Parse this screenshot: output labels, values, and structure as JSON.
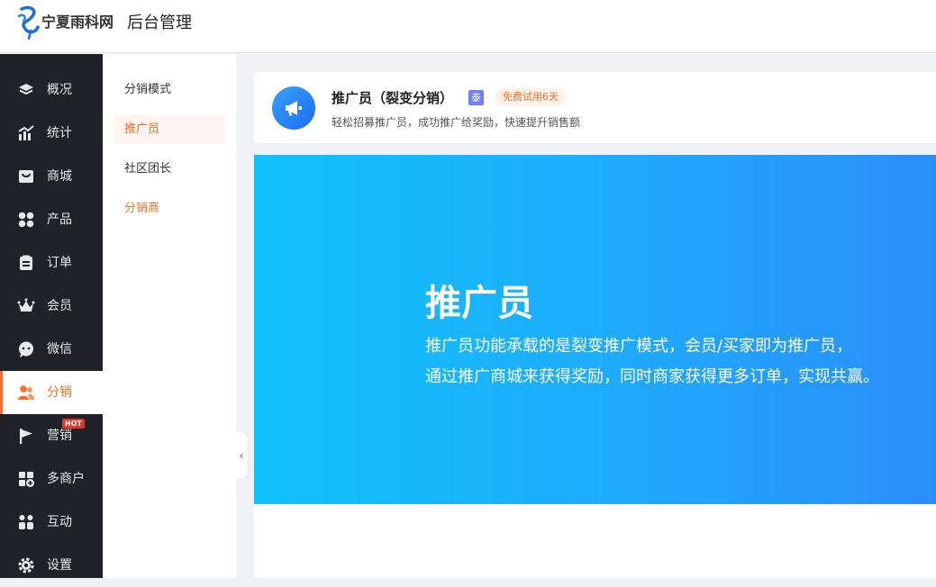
{
  "header": {
    "brand_text": "宁夏雨科网",
    "admin_title": "后台管理"
  },
  "sidebar": {
    "items": [
      {
        "label": "概况",
        "icon": "layers-icon"
      },
      {
        "label": "统计",
        "icon": "chart-icon"
      },
      {
        "label": "商城",
        "icon": "shop-icon"
      },
      {
        "label": "产品",
        "icon": "grid-icon"
      },
      {
        "label": "订单",
        "icon": "order-icon"
      },
      {
        "label": "会员",
        "icon": "crown-icon"
      },
      {
        "label": "微信",
        "icon": "chat-icon"
      },
      {
        "label": "分销",
        "icon": "users-icon",
        "active": true
      },
      {
        "label": "营销",
        "icon": "flag-icon",
        "badge": "HOT"
      },
      {
        "label": "多商户",
        "icon": "store-add-icon"
      },
      {
        "label": "互动",
        "icon": "interact-icon"
      },
      {
        "label": "设置",
        "icon": "gear-icon"
      }
    ]
  },
  "subnav": {
    "items": [
      {
        "label": "分销模式"
      },
      {
        "label": "推广员",
        "active": true
      },
      {
        "label": "社区团长"
      },
      {
        "label": "分销商"
      }
    ],
    "collapse_glyph": "‹"
  },
  "feature_card": {
    "title": "推广员（裂变分销）",
    "vip_badge": "泰",
    "trial_badge": "免费试用6天",
    "description": "轻松招募推广员，成功推广给奖励，快速提升销售额",
    "icon": "megaphone-icon"
  },
  "banner": {
    "title": "推广员",
    "line1": "推广员功能承载的是裂变推广模式，会员/买家即为推广员，",
    "line2": "通过推广商城来获得奖励，同时商家获得更多订单，实现共赢。"
  },
  "colors": {
    "accent": "#f0702e",
    "sidebar_bg": "#1f2226",
    "banner_start": "#10c2fb",
    "banner_end": "#2b8ffb"
  }
}
